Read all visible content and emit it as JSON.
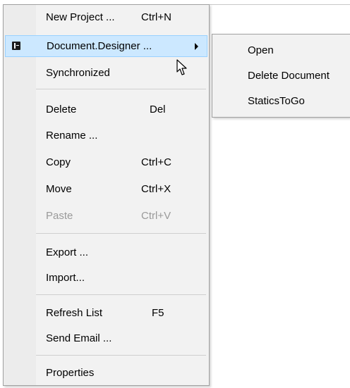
{
  "menu": {
    "items": [
      {
        "label": "New Project ...",
        "shortcut": "Ctrl+N"
      },
      {
        "label": "Document.Designer ...",
        "shortcut": ""
      },
      {
        "label": "Synchronized",
        "shortcut": ""
      },
      {
        "label": "Delete",
        "shortcut": "Del"
      },
      {
        "label": "Rename ...",
        "shortcut": ""
      },
      {
        "label": "Copy",
        "shortcut": "Ctrl+C"
      },
      {
        "label": "Move",
        "shortcut": "Ctrl+X"
      },
      {
        "label": "Paste",
        "shortcut": "Ctrl+V"
      },
      {
        "label": "Export ...",
        "shortcut": ""
      },
      {
        "label": "Import...",
        "shortcut": ""
      },
      {
        "label": "Refresh List",
        "shortcut": "F5"
      },
      {
        "label": "Send Email ...",
        "shortcut": ""
      },
      {
        "label": "Properties",
        "shortcut": ""
      }
    ]
  },
  "submenu": {
    "items": [
      {
        "label": "Open"
      },
      {
        "label": "Delete Document"
      },
      {
        "label": "StaticsToGo"
      }
    ]
  },
  "colors": {
    "menu_bg": "#f2f2f2",
    "highlight": "#cce8ff",
    "highlight_border": "#99d1ff",
    "disabled_text": "#9a9a9a"
  },
  "icons": {
    "document_designer": "document-icon",
    "submenu_arrow": "chevron-right-icon",
    "cursor": "mouse-pointer-icon"
  }
}
